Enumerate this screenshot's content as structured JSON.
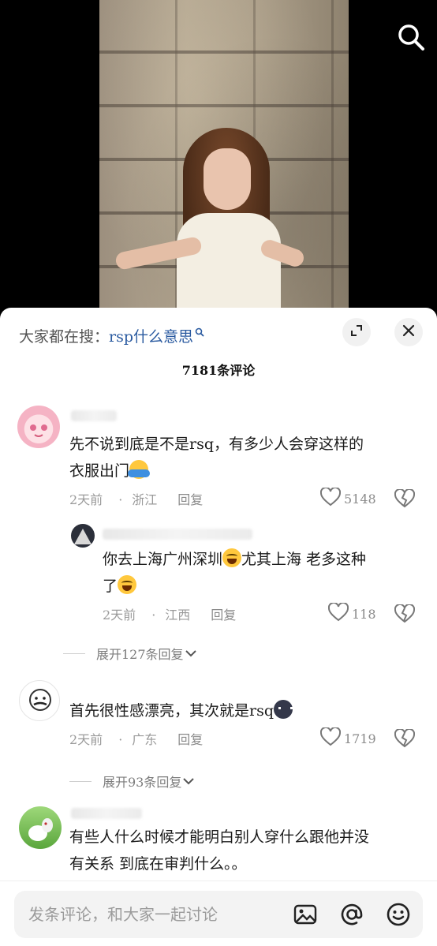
{
  "video": {
    "search_icon": "search-icon"
  },
  "sheet": {
    "hot_search_prefix": "大家都在搜：",
    "hot_search_query": "rsp什么意思",
    "comment_count": "7181条评论"
  },
  "comments": [
    {
      "text_lines": [
        "先不说到底是不是rsq，有多少人会穿这样的",
        "衣服出门"
      ],
      "time": "2天前",
      "location": "浙江",
      "reply_label": "回复",
      "likes": "5148"
    },
    {
      "text_lines": [
        "你去上海广州深圳",
        "尤其上海  老多这种",
        "了"
      ],
      "time": "2天前",
      "location": "江西",
      "reply_label": "回复",
      "likes": "118"
    },
    {
      "expand_label": "展开127条回复"
    },
    {
      "text_lines": [
        "首先很性感漂亮，其次就是rsq"
      ],
      "time": "2天前",
      "location": "广东",
      "reply_label": "回复",
      "likes": "1719"
    },
    {
      "expand_label": "展开93条回复"
    },
    {
      "text_lines": [
        "有些人什么时候才能明白别人穿什么跟他并没",
        "有关系  到底在审判什么。。"
      ]
    }
  ],
  "input": {
    "placeholder": "发条评论，和大家一起讨论"
  }
}
